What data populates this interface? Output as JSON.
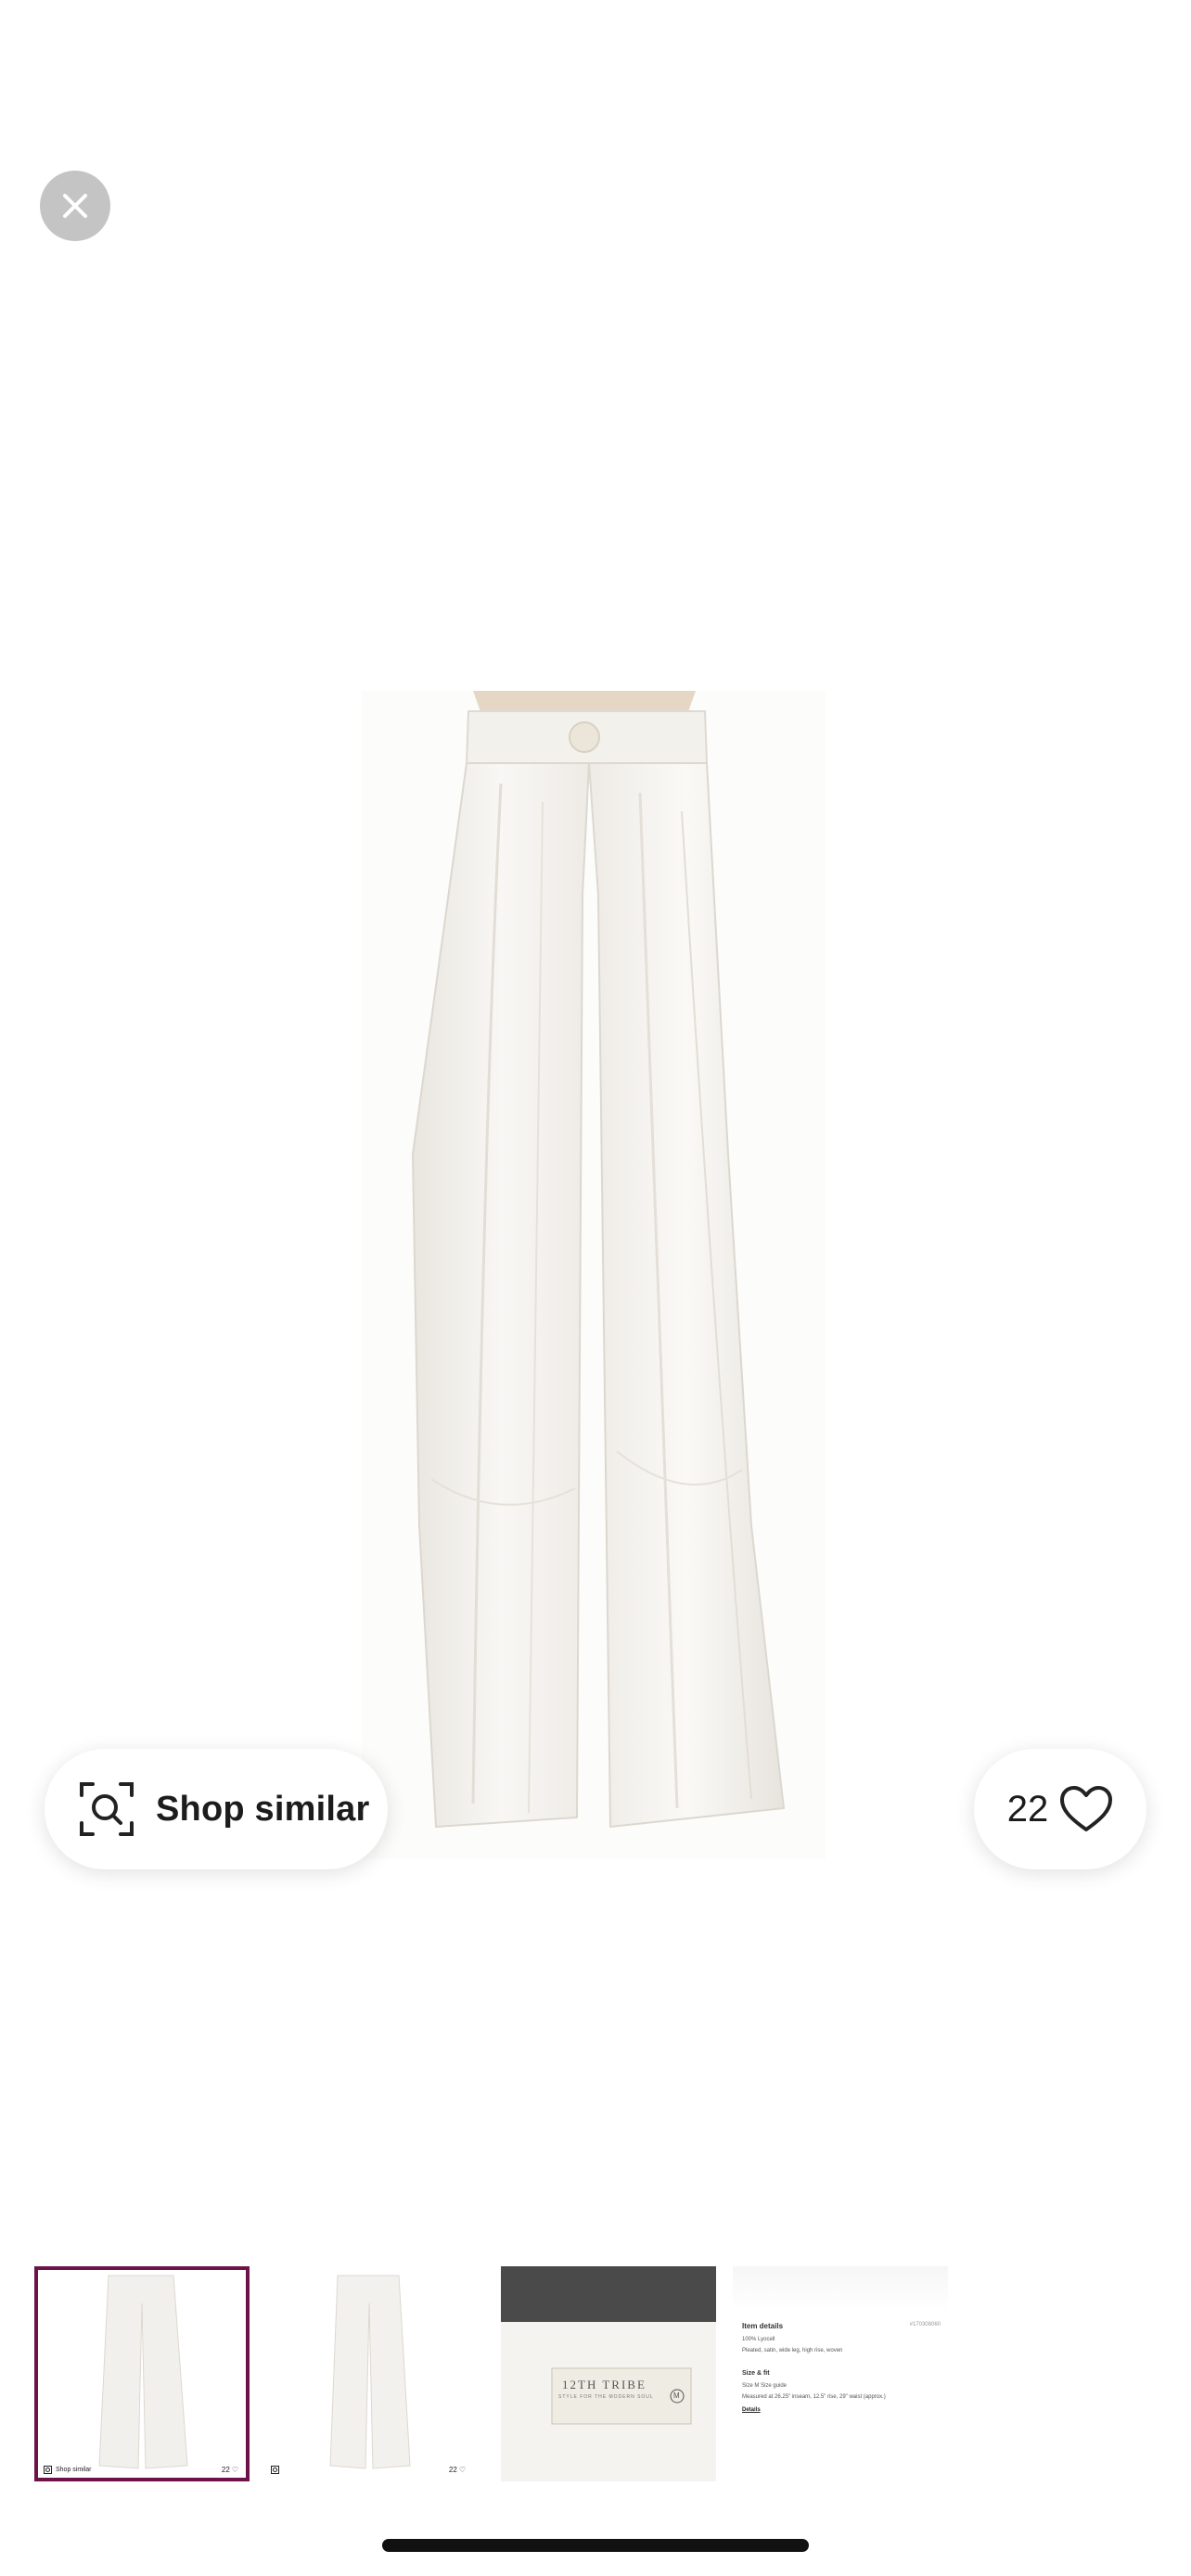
{
  "actions": {
    "shop_similar_label": "Shop similar",
    "like_count": "22"
  },
  "thumbnails": [
    {
      "name": "front-view",
      "mini_shop_label": "Shop similar",
      "mini_like_count": "22"
    },
    {
      "name": "back-view",
      "mini_like_count": "22"
    },
    {
      "name": "brand-label",
      "brand_text": "12TH TRIBE",
      "brand_sub": "STYLE FOR THE MODERN SOUL",
      "size_text": "M"
    },
    {
      "name": "item-details",
      "title": "Item details",
      "item_id": "#170308060",
      "material": "100% Lyocell",
      "features": "Pleated, satin, wide leg, high rise, woven",
      "size_heading": "Size & fit",
      "size_guide": "Size M Size guide",
      "measurements": "Measured at 26.25\" inseam, 12.5\" rise, 29\" waist (approx.)",
      "details_link": "Details"
    }
  ],
  "colors": {
    "selected_border": "#6c1449",
    "close_button_bg": "#c4c4c4"
  },
  "icons": {
    "close": "close-icon",
    "shop_similar": "visual-search-icon",
    "like": "heart-icon"
  }
}
